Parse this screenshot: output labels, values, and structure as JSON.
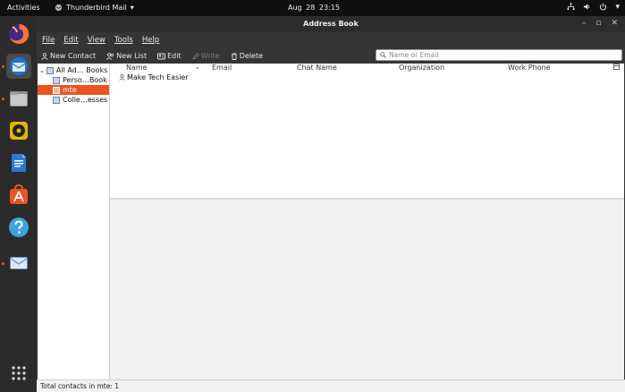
{
  "topbar": {
    "activities": "Activities",
    "app_name": "Thunderbird Mail",
    "date": "Aug 28",
    "time": "23:15"
  },
  "dock": {
    "apps": [
      {
        "name": "firefox-icon",
        "color": "#ff7139"
      },
      {
        "name": "thunderbird-icon",
        "color": "#3a7bd5"
      },
      {
        "name": "files-icon",
        "color": "#c9a66b"
      },
      {
        "name": "rhythmbox-icon",
        "color": "#e4b600"
      },
      {
        "name": "libreoffice-writer-icon",
        "color": "#2a7ad5"
      },
      {
        "name": "software-center-icon",
        "color": "#e95420"
      },
      {
        "name": "help-icon",
        "color": "#3ba3e0"
      },
      {
        "name": "mail-icon",
        "color": "#5a8fd6"
      }
    ]
  },
  "window": {
    "title": "Address Book"
  },
  "menu": [
    "File",
    "Edit",
    "View",
    "Tools",
    "Help"
  ],
  "toolbar": {
    "new_contact": "New Contact",
    "new_list": "New List",
    "edit": "Edit",
    "write": "Write",
    "delete": "Delete"
  },
  "search": {
    "placeholder": "Name or Email"
  },
  "tree": [
    {
      "label": "All Ad… Books",
      "selected": false
    },
    {
      "label": "Perso…Book",
      "selected": false
    },
    {
      "label": "mte",
      "selected": true
    },
    {
      "label": "Colle…esses",
      "selected": false
    }
  ],
  "columns": [
    "Name",
    "Email",
    "Chat Name",
    "Organization",
    "Work Phone"
  ],
  "contacts": [
    {
      "name": "Make Tech Easier",
      "email": "",
      "chat": "",
      "org": "",
      "phone": ""
    }
  ],
  "status": "Total contacts in mte: 1",
  "colors": {
    "accent": "#e95420",
    "window_bg": "#353535",
    "topbar_bg": "#0f0f0f"
  }
}
